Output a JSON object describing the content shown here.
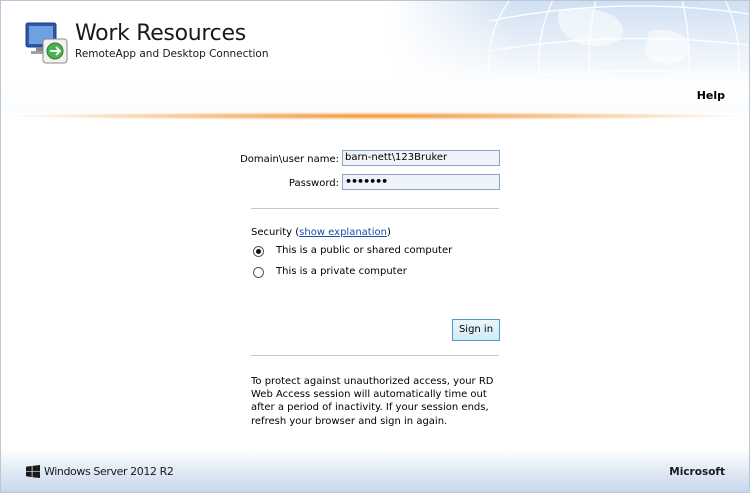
{
  "header": {
    "title": "Work Resources",
    "subtitle": "RemoteApp and Desktop Connection",
    "help_label": "Help"
  },
  "form": {
    "username_label": "Domain\\user name:",
    "username_value": "barn-nett\\123Bruker",
    "password_label": "Password:",
    "password_value": "•••••••",
    "security_prefix": "Security (",
    "security_link": "show explanation",
    "security_suffix": ")",
    "options": [
      {
        "label": "This is a public or shared computer",
        "checked": true
      },
      {
        "label": "This is a private computer",
        "checked": false
      }
    ],
    "signin_label": "Sign in",
    "notice": "To protect against unauthorized access, your RD Web Access session will automatically time out after a period of inactivity. If your session ends, refresh your browser and sign in again."
  },
  "footer": {
    "product": "Windows Server 2012 R2",
    "brand": "Microsoft"
  },
  "colors": {
    "accent_orange": "#f08c28",
    "link_blue": "#1b4fa8",
    "button_border": "#4a9ac8"
  }
}
